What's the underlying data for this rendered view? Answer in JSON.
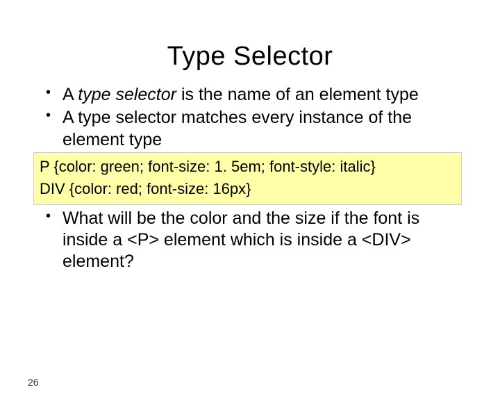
{
  "title": "Type Selector",
  "bullets_top": [
    {
      "pre": "A ",
      "italic": "type selector ",
      "post": " is the name of an element type"
    },
    {
      "pre": "A type selector matches every instance of the element type",
      "italic": "",
      "post": ""
    }
  ],
  "code_lines": [
    "P {color: green; font-size: 1. 5em; font-style: italic}",
    "DIV {color: red; font-size: 16px}"
  ],
  "bullets_bottom": [
    "What will be the color and the size if the font is inside a <P> element which is inside a <DIV> element?"
  ],
  "page_number": "26"
}
